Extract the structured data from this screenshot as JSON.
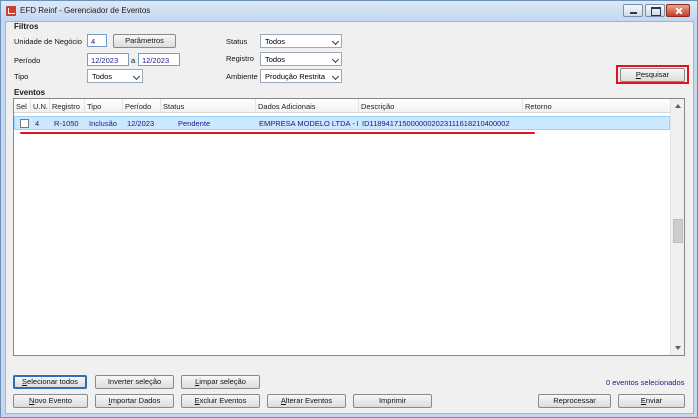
{
  "window": {
    "title": "EFD Reinf - Gerenciador de Eventos",
    "icon": "app-check-icon",
    "controls": [
      "minimize-icon",
      "maximize-icon",
      "close-icon"
    ]
  },
  "filters": {
    "title": "Filtros",
    "unidade_label": "Unidade de Negócio",
    "unidade_value": "4",
    "parametros_label": "Parâmetros",
    "periodo_label": "Período",
    "periodo_from": "12/2023",
    "periodo_sep": "a",
    "periodo_to": "12/2023",
    "tipo_label": "Tipo",
    "tipo_value": "Todos",
    "status_label": "Status",
    "status_value": "Todos",
    "registro_label": "Registro",
    "registro_value": "Todos",
    "ambiente_label": "Ambiente",
    "ambiente_value": "Produção Restrita",
    "pesquisar_label": "Pesquisar"
  },
  "events": {
    "title": "Eventos",
    "columns": [
      "Sel",
      "U.N.",
      "Registro",
      "Tipo",
      "Período",
      "Status",
      "Dados Adicionais",
      "Descrição",
      "Retorno"
    ],
    "rows": [
      {
        "sel": false,
        "un": "4",
        "registro": "R-1050",
        "tipo": "Inclusão",
        "periodo": "12/2023",
        "status": "Pendente",
        "dados": "EMPRESA MODELO LTDA - F",
        "descricao": "ID1189417150000002023111618210400002",
        "retorno": ""
      }
    ]
  },
  "footer": {
    "selecionar_todos": "Selecionar todos",
    "inverter": "Inverter seleção",
    "limpar": "Limpar seleção",
    "selected_count": "0 eventos selecionados",
    "novo_evento": "Novo Evento",
    "importar": "Importar Dados",
    "excluir": "Excluir Eventos",
    "alterar": "Alterar Eventos",
    "imprimir": "Imprimir",
    "reprocessar": "Reprocessar",
    "enviar": "Enviar"
  },
  "colors": {
    "accent": "#e0141e",
    "row_selected": "#cce8ff",
    "link_text": "#1a1a80"
  }
}
